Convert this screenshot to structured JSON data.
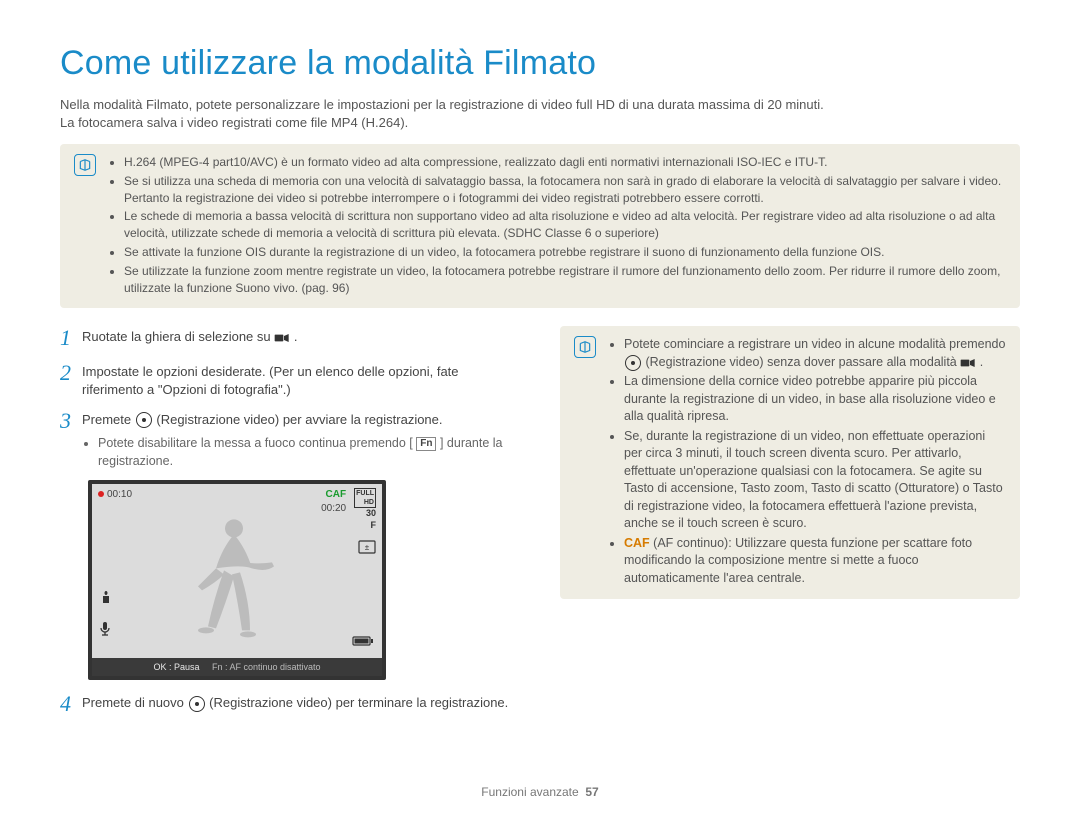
{
  "title": "Come utilizzare la modalità Filmato",
  "intro_line1": "Nella modalità Filmato, potete personalizzare le impostazioni per la registrazione di video full HD di una durata massima di 20 minuti.",
  "intro_line2": "La fotocamera salva i video registrati come file MP4 (H.264).",
  "note1": {
    "items": [
      "H.264 (MPEG-4 part10/AVC) è un formato video ad alta compressione, realizzato dagli enti normativi internazionali ISO-IEC e ITU-T.",
      "Se si utilizza una scheda di memoria con una velocità di salvataggio bassa, la fotocamera non sarà in grado di elaborare la velocità di salvataggio per salvare i video. Pertanto la registrazione dei video si potrebbe interrompere o i fotogrammi dei video registrati potrebbero essere corrotti.",
      "Le schede di memoria a bassa velocità di scrittura non supportano video ad alta risoluzione e video ad alta velocità. Per registrare video ad alta risoluzione o ad alta velocità, utilizzate schede di memoria a velocità di scrittura più elevata. (SDHC Classe 6 o superiore)",
      "Se attivate la funzione OIS durante la registrazione di un video, la fotocamera potrebbe registrare il suono di funzionamento della funzione OIS.",
      "Se utilizzate la funzione zoom mentre registrate un video, la fotocamera potrebbe registrare il rumore del funzionamento dello zoom. Per ridurre il rumore dello zoom, utilizzate la funzione Suono vivo. (pag. 96)"
    ]
  },
  "steps": {
    "s1": "Ruotate la ghiera di selezione su ",
    "s1_end": ".",
    "s2": "Impostate le opzioni desiderate. (Per un elenco delle opzioni, fate riferimento a \"Opzioni di fotografia\".)",
    "s3_a": "Premete ",
    "s3_b": " (Registrazione video) per avviare la registrazione.",
    "s3_sub_a": "Potete disabilitare la messa a fuoco continua premendo [",
    "s3_sub_b": "] durante la registrazione.",
    "s4_a": "Premete di nuovo ",
    "s4_b": " (Registrazione video) per terminare la registrazione."
  },
  "lcd": {
    "time_elapsed": "00:10",
    "time_remain": "00:20",
    "caf": "CAF",
    "bottom_left": "OK : Pausa",
    "bottom_right": "Fn : AF continuo disattivato"
  },
  "note2": {
    "item1_a": "Potete cominciare a registrare un video in alcune modalità premendo ",
    "item1_b": " (Registrazione video) senza dover passare alla modalità ",
    "item1_c": ".",
    "item2": "La dimensione della cornice video potrebbe apparire più piccola durante la registrazione di un video, in base alla risoluzione video e alla qualità ripresa.",
    "item3": "Se, durante la registrazione di un video, non effettuate operazioni per circa 3 minuti, il touch screen diventa scuro. Per attivarlo, effettuate un'operazione qualsiasi con la fotocamera. Se agite su Tasto di accensione, Tasto zoom, Tasto di scatto (Otturatore) o Tasto di registrazione video, la fotocamera effettuerà l'azione prevista, anche se il touch screen è scuro.",
    "item4_label": "CAF",
    "item4_rest": " (AF continuo): Utilizzare questa funzione per scattare foto modificando la composizione mentre si mette a fuoco automaticamente l'area centrale."
  },
  "footer": {
    "section": "Funzioni avanzate",
    "page": "57"
  }
}
